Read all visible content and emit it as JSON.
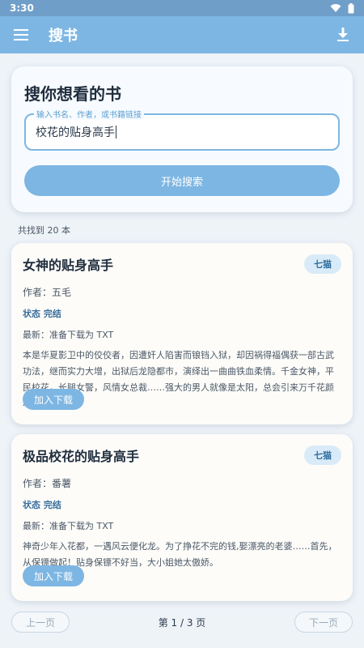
{
  "statusbar": {
    "time": "3:30"
  },
  "appbar": {
    "title": "搜书"
  },
  "search": {
    "heading": "搜你想看的书",
    "legend": "输入书名、作者，或书籍链接",
    "value": "校花的贴身高手",
    "button": "开始搜索"
  },
  "results": {
    "count_text": "共找到 20 本"
  },
  "books": [
    {
      "name": "女神的贴身高手",
      "source": "七猫",
      "author": "作者：五毛",
      "status": "状态 完结",
      "latest": "最新：准备下载为 TXT",
      "desc": "本是华夏影卫中的佼佼者，因遭奸人陷害而锒铛入狱，却因祸得福偶获一部古武功法，继而实力大增，出狱后龙隐都市，演绎出一曲曲铁血柔情。千金女神，平民校花，长腿女警，风情女总裁……强大的男人就像是太阳，总会引来万千花颜尽投怀。",
      "add": "加入下载"
    },
    {
      "name": "极品校花的贴身高手",
      "source": "七猫",
      "author": "作者：番薯",
      "status": "状态 完结",
      "latest": "最新：准备下载为 TXT",
      "desc": "神奇少年入花都，一遇风云便化龙。为了挣花不完的钱,娶漂亮的老婆……首先，从保镖做起！贴身保镖不好当，大小姐她太傲娇。",
      "add": "加入下载"
    }
  ],
  "pager": {
    "prev": "上一页",
    "info": "第 1 / 3 页",
    "next": "下一页"
  },
  "colors": {
    "accent": "#7db6e3",
    "appbar": "#7db6e3",
    "statusbar": "#6f9ec9"
  }
}
